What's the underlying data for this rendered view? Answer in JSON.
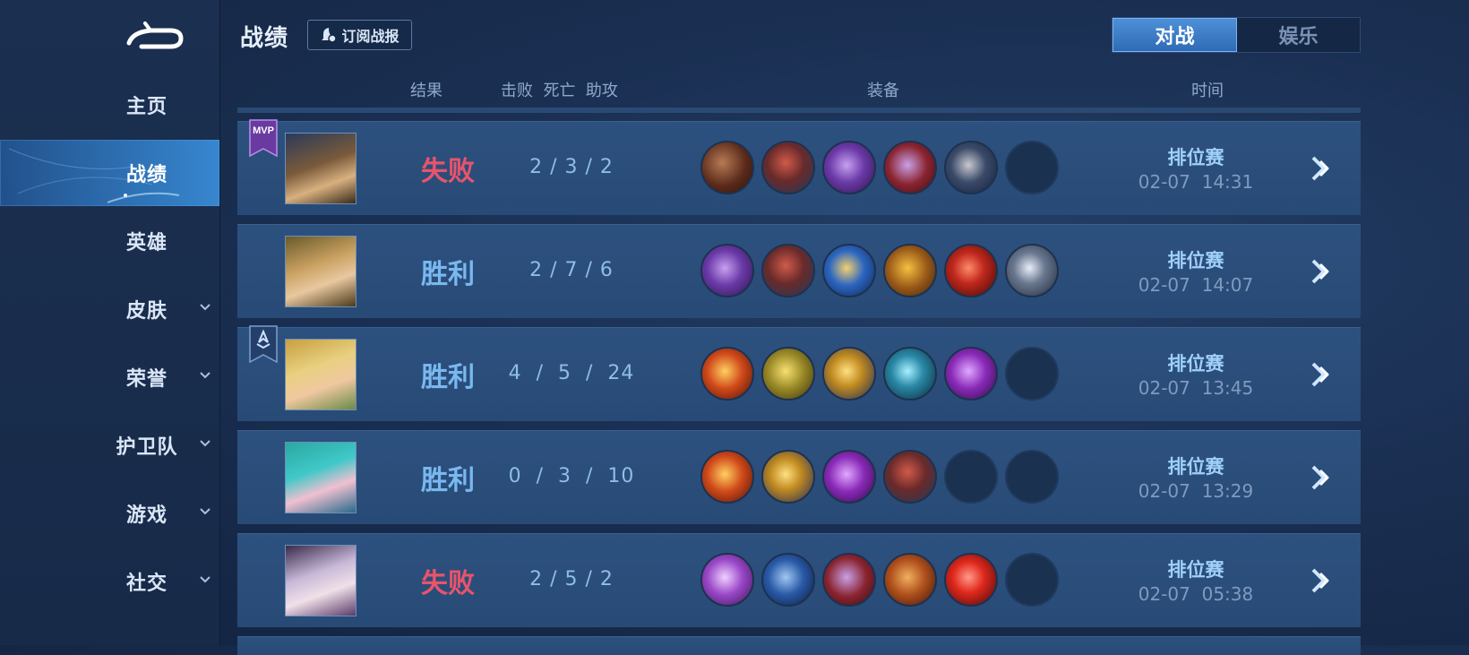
{
  "sidebar": {
    "back_icon": "back-arrow-icon",
    "items": [
      {
        "label": "主页",
        "active": false,
        "expandable": false
      },
      {
        "label": "战绩",
        "active": true,
        "expandable": false
      },
      {
        "label": "英雄",
        "active": false,
        "expandable": false
      },
      {
        "label": "皮肤",
        "active": false,
        "expandable": true
      },
      {
        "label": "荣誉",
        "active": false,
        "expandable": true
      },
      {
        "label": "护卫队",
        "active": false,
        "expandable": true
      },
      {
        "label": "游戏",
        "active": false,
        "expandable": true
      },
      {
        "label": "社交",
        "active": false,
        "expandable": true
      }
    ]
  },
  "header": {
    "title": "战绩",
    "subscribe_label": "订阅战报",
    "tabs": [
      {
        "label": "对战",
        "active": true
      },
      {
        "label": "娱乐",
        "active": false
      }
    ]
  },
  "columns": {
    "result": "结果",
    "kda": "击败  死亡  助攻",
    "items": "装备",
    "time": "时间"
  },
  "colors": {
    "lose": "#e8546b",
    "win": "#79b8f0",
    "accent": "#3d82cf"
  },
  "matches": [
    {
      "badge": "MVP",
      "result": "失败",
      "outcome": "lose",
      "kda": "2 / 3 / 2",
      "items": [
        "brown-blade",
        "red-boots",
        "purple-axe",
        "crimson-gauntlet",
        "dark-spear",
        "empty"
      ],
      "mode": "排位赛",
      "time": "02-07  14:31"
    },
    {
      "badge": "",
      "result": "胜利",
      "outcome": "win",
      "kda": "2 / 7 / 6",
      "items": [
        "purple-axe",
        "red-boots",
        "blue-spear",
        "golden-crescent",
        "red-orb",
        "silver-arrow"
      ],
      "mode": "排位赛",
      "time": "02-07  14:07"
    },
    {
      "badge": "team-banner",
      "result": "胜利",
      "outcome": "win",
      "kda": "4  /  5  /  24",
      "items": [
        "fire-medal",
        "golden-boots",
        "gold-chalice",
        "teal-scythe",
        "purple-staff",
        "empty"
      ],
      "mode": "排位赛",
      "time": "02-07  13:45"
    },
    {
      "badge": "",
      "result": "胜利",
      "outcome": "win",
      "kda": "0  /  3  /  10",
      "items": [
        "fire-medal",
        "gold-chalice",
        "purple-staff",
        "red-boots",
        "empty",
        "empty"
      ],
      "mode": "排位赛",
      "time": "02-07  13:29"
    },
    {
      "badge": "",
      "result": "失败",
      "outcome": "lose",
      "kda": "2 / 5 / 2",
      "items": [
        "purple-hammer",
        "blue-boots",
        "crimson-gauntlet",
        "bronze-armor",
        "red-crystal",
        "empty"
      ],
      "mode": "排位赛",
      "time": "02-07  05:38"
    }
  ]
}
